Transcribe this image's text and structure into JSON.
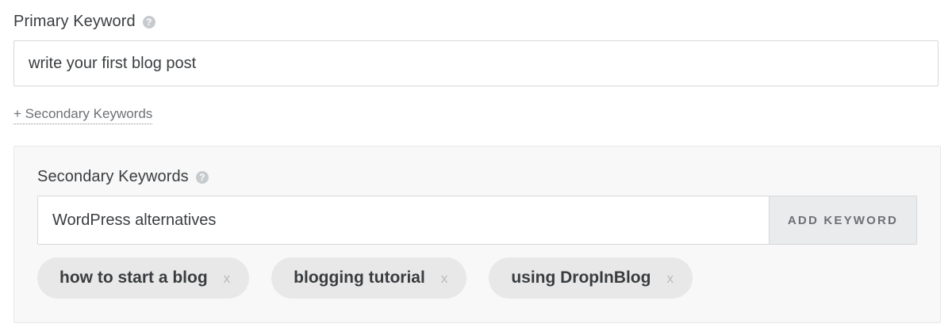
{
  "primary": {
    "label": "Primary Keyword",
    "help_icon": "?",
    "value": "write your first blog post"
  },
  "secondary_toggle": {
    "label": "+ Secondary Keywords"
  },
  "secondary": {
    "label": "Secondary Keywords",
    "help_icon": "?",
    "value": "WordPress alternatives",
    "add_button": "ADD KEYWORD",
    "tags": [
      {
        "label": "how to start a blog",
        "remove": "x"
      },
      {
        "label": "blogging tutorial",
        "remove": "x"
      },
      {
        "label": "using DropInBlog",
        "remove": "x"
      }
    ]
  },
  "icons": {
    "help": "question-circle-icon",
    "remove": "close-icon"
  }
}
